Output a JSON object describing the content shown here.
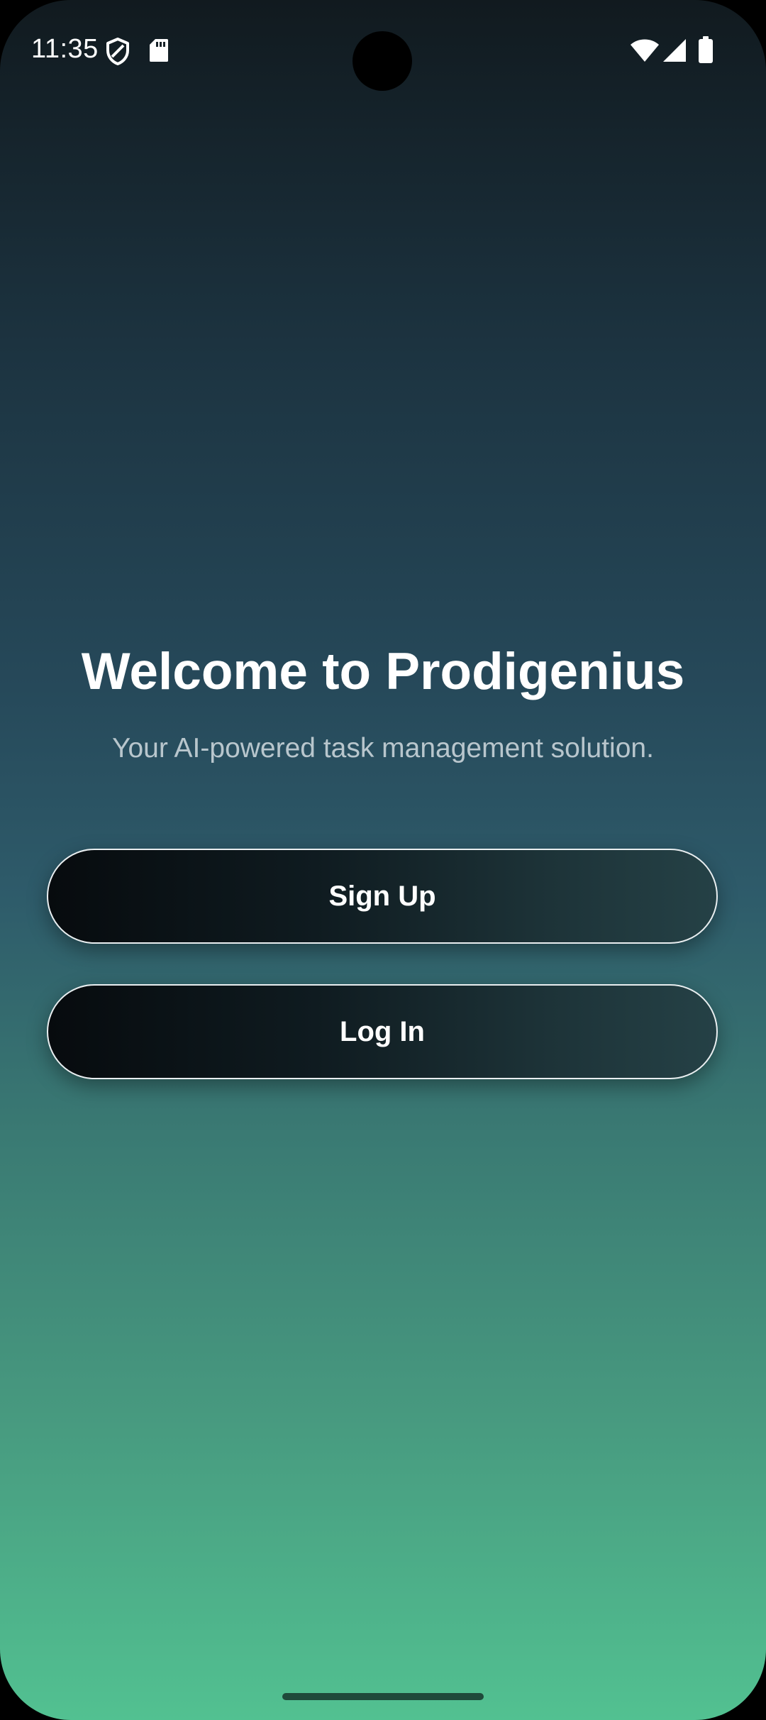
{
  "status_bar": {
    "time": "11:35",
    "icons": [
      "vpn-shield-icon",
      "sd-card-icon",
      "wifi-icon",
      "cellular-signal-icon",
      "battery-icon"
    ]
  },
  "welcome": {
    "title": "Welcome to Prodigenius",
    "subtitle": "Your AI-powered task management solution."
  },
  "actions": {
    "signup_label": "Sign Up",
    "login_label": "Log In"
  },
  "colors": {
    "gradient_top": "#111a1f",
    "gradient_bottom": "#52c191",
    "button_border": "#e9eef0",
    "text": "#ffffff"
  }
}
